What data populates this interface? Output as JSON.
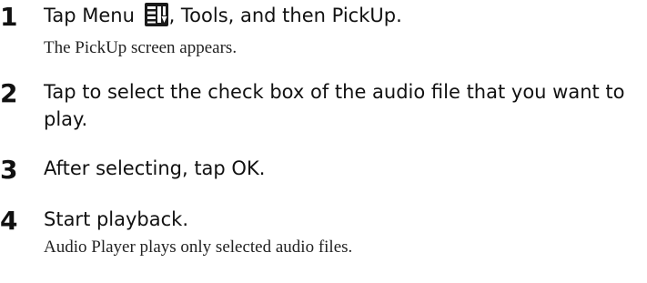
{
  "steps": [
    {
      "number": "1",
      "instruction_before_icon": "Tap Menu ",
      "icon": "menu-icon",
      "instruction_after_icon": ", Tools, and then PickUp.",
      "result": "The PickUp screen appears."
    },
    {
      "number": "2",
      "instruction": "Tap to select the check box of the audio file that you want to play."
    },
    {
      "number": "3",
      "instruction": "After selecting, tap OK."
    },
    {
      "number": "4",
      "instruction": "Start playback.",
      "result": "Audio Player plays only selected audio files."
    }
  ]
}
